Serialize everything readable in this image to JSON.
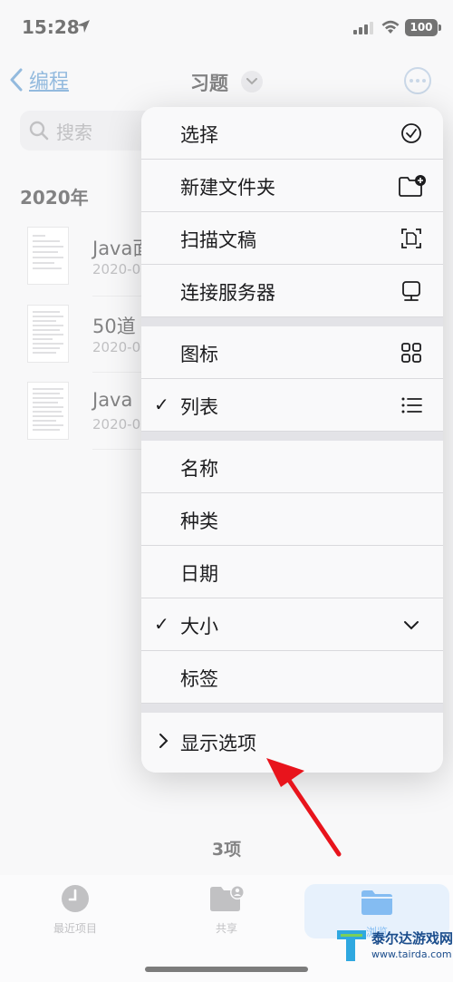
{
  "status": {
    "time": "15:28",
    "battery": "100"
  },
  "nav": {
    "back_label": "编程",
    "title": "习题"
  },
  "search": {
    "placeholder": "搜索"
  },
  "section": {
    "year": "2020年"
  },
  "files": [
    {
      "name": "Java面",
      "date": "2020-0"
    },
    {
      "name": "50道",
      "date": "2020-0"
    },
    {
      "name": "Java",
      "date": "2020-0"
    }
  ],
  "menu": {
    "items": [
      {
        "label": "选择",
        "icon": "checkmark-circle-icon"
      },
      {
        "label": "新建文件夹",
        "icon": "folder-add-icon"
      },
      {
        "label": "扫描文稿",
        "icon": "scan-document-icon"
      },
      {
        "label": "连接服务器",
        "icon": "server-icon"
      },
      {
        "label": "图标",
        "icon": "grid-icon"
      },
      {
        "label": "列表",
        "icon": "list-icon",
        "checked": true
      },
      {
        "label": "名称"
      },
      {
        "label": "种类"
      },
      {
        "label": "日期"
      },
      {
        "label": "大小",
        "checked": true,
        "icon": "chevron-down-icon"
      },
      {
        "label": "标签"
      },
      {
        "label": "显示选项",
        "icon": "chevron-right-icon"
      }
    ]
  },
  "footer": {
    "count": "3项"
  },
  "tabs": [
    {
      "label": "最近项目",
      "icon": "clock-icon"
    },
    {
      "label": "共享",
      "icon": "shared-folder-icon"
    },
    {
      "label": "浏览",
      "icon": "folder-icon",
      "active": true
    }
  ],
  "colors": {
    "accent": "#1f86e8",
    "arrow": "#e8141c"
  },
  "watermark": {
    "title": "泰尔达游戏网",
    "url": "www.tairda.com"
  }
}
